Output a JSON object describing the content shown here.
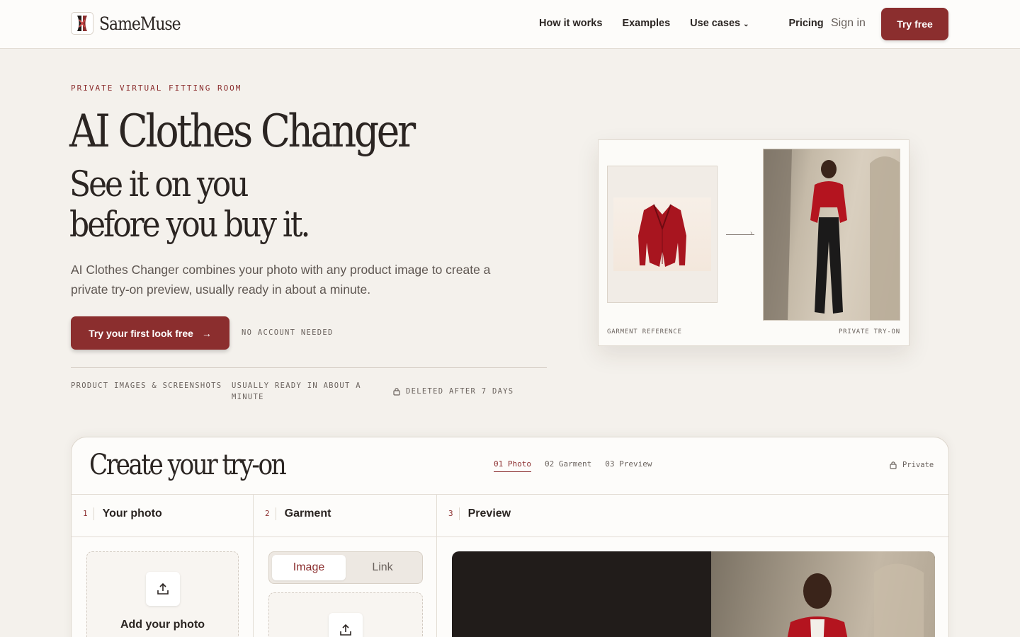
{
  "nav": {
    "brand": "SameMuse",
    "links": [
      "How it works",
      "Examples",
      "Use cases",
      "Pricing"
    ],
    "signin": "Sign in",
    "cta": "Try free"
  },
  "hero": {
    "eyebrow": "PRIVATE VIRTUAL FITTING ROOM",
    "title": "AI Clothes Changer",
    "subtitle_line1": "See it on you",
    "subtitle_line2": "before you buy it.",
    "lead": "AI Clothes Changer combines your photo with any product image to create a private try-on preview, usually ready in about a minute.",
    "cta": "Try your first look free",
    "cta_arrow": "→",
    "note": "NO ACCOUNT NEEDED",
    "features": [
      "PRODUCT IMAGES & SCREENSHOTS",
      "USUALLY READY IN ABOUT A MINUTE",
      "DELETED AFTER 7 DAYS"
    ]
  },
  "preview_card": {
    "left_label": "GARMENT REFERENCE",
    "right_label": "PRIVATE TRY-ON"
  },
  "create": {
    "title": "Create your try-on",
    "steps": [
      "01 Photo",
      "02 Garment",
      "03 Preview"
    ],
    "active_step": "01 Photo",
    "private_label": "Private",
    "columns": [
      {
        "num": "1",
        "title": "Your photo"
      },
      {
        "num": "2",
        "title": "Garment"
      },
      {
        "num": "3",
        "title": "Preview"
      }
    ],
    "add_photo": "Add your photo",
    "toggle": [
      "Image",
      "Link"
    ]
  },
  "colors": {
    "accent": "#8b2e2e",
    "background": "#f4f1ec",
    "text": "#2b2522"
  }
}
